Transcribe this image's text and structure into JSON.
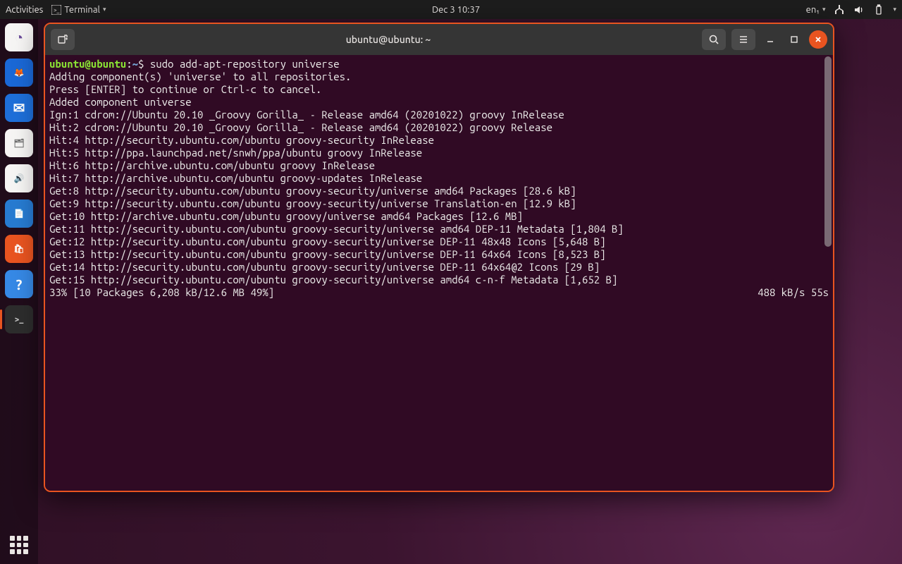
{
  "topbar": {
    "activities": "Activities",
    "app_menu": "Terminal",
    "datetime": "Dec 3  10:37",
    "input_lang": "en₁"
  },
  "dock": {
    "items": [
      {
        "name": "nautilus-live",
        "bg": "#f6f5f4",
        "glyph": "◔",
        "fg": "#6b4c9a"
      },
      {
        "name": "firefox",
        "bg": "#1a68d6",
        "glyph": "🦊",
        "fg": "#ff8a00"
      },
      {
        "name": "thunderbird",
        "bg": "#1e6fd9",
        "glyph": "✉",
        "fg": "#fff"
      },
      {
        "name": "files",
        "bg": "#f6f5f4",
        "glyph": "🗂",
        "fg": "#6c6c6c"
      },
      {
        "name": "rhythmbox",
        "bg": "#f6f5f4",
        "glyph": "🔊",
        "fg": "#333"
      },
      {
        "name": "libreoffice-writer",
        "bg": "#277bd1",
        "glyph": "📄",
        "fg": "#fff"
      },
      {
        "name": "software",
        "bg": "#e95420",
        "glyph": "🛍",
        "fg": "#fff"
      },
      {
        "name": "help",
        "bg": "#3689e6",
        "glyph": "?",
        "fg": "#fff"
      },
      {
        "name": "terminal",
        "bg": "#2d2d2d",
        "glyph": ">_",
        "fg": "#ccc",
        "running": true
      }
    ]
  },
  "window": {
    "title": "ubuntu@ubuntu: ~"
  },
  "terminal": {
    "prompt_user": "ubuntu@ubuntu",
    "prompt_path": "~",
    "prompt_sep": ":",
    "prompt_dollar": "$",
    "command": "sudo add-apt-repository universe",
    "lines": [
      "Adding component(s) 'universe' to all repositories.",
      "Press [ENTER] to continue or Ctrl-c to cancel.",
      "Added component universe",
      "Ign:1 cdrom://Ubuntu 20.10 _Groovy Gorilla_ - Release amd64 (20201022) groovy InRelease",
      "Hit:2 cdrom://Ubuntu 20.10 _Groovy Gorilla_ - Release amd64 (20201022) groovy Release",
      "Hit:4 http://security.ubuntu.com/ubuntu groovy-security InRelease",
      "Hit:5 http://ppa.launchpad.net/snwh/ppa/ubuntu groovy InRelease",
      "Hit:6 http://archive.ubuntu.com/ubuntu groovy InRelease",
      "Hit:7 http://archive.ubuntu.com/ubuntu groovy-updates InRelease",
      "Get:8 http://security.ubuntu.com/ubuntu groovy-security/universe amd64 Packages [28.6 kB]",
      "Get:9 http://security.ubuntu.com/ubuntu groovy-security/universe Translation-en [12.9 kB]",
      "Get:10 http://archive.ubuntu.com/ubuntu groovy/universe amd64 Packages [12.6 MB]",
      "Get:11 http://security.ubuntu.com/ubuntu groovy-security/universe amd64 DEP-11 Metadata [1,804 B]",
      "Get:12 http://security.ubuntu.com/ubuntu groovy-security/universe DEP-11 48x48 Icons [5,648 B]",
      "Get:13 http://security.ubuntu.com/ubuntu groovy-security/universe DEP-11 64x64 Icons [8,523 B]",
      "Get:14 http://security.ubuntu.com/ubuntu groovy-security/universe DEP-11 64x64@2 Icons [29 B]",
      "Get:15 http://security.ubuntu.com/ubuntu groovy-security/universe amd64 c-n-f Metadata [1,652 B]"
    ],
    "progress_left": "33% [10 Packages 6,208 kB/12.6 MB 49%]",
    "progress_right": "488 kB/s 55s"
  }
}
